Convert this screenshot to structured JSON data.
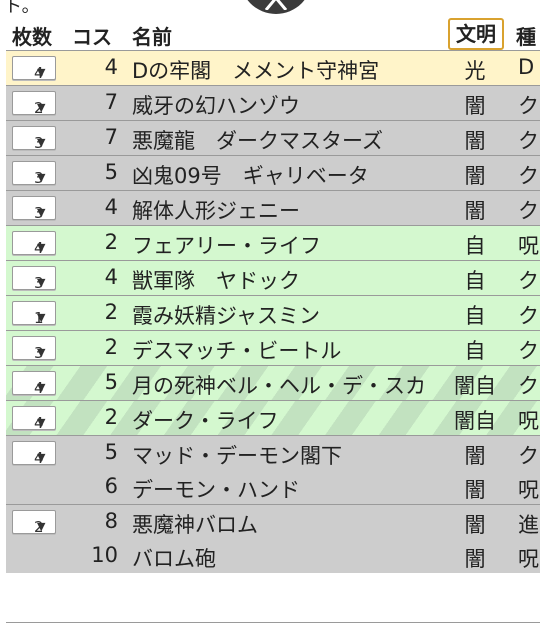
{
  "top_fragment": "ト。",
  "header": {
    "qty": "枚数",
    "cost": "コス",
    "name": "名前",
    "civ": "文明",
    "race": "種"
  },
  "rows": [
    {
      "qty": "4",
      "cost": "4",
      "name": "Dの牢閣　メメント守神宮",
      "civ": "光",
      "race": "D"
    },
    {
      "qty": "2",
      "cost": "7",
      "name": "威牙の幻ハンゾウ",
      "civ": "闇",
      "race": "ク"
    },
    {
      "qty": "3",
      "cost": "7",
      "name": "悪魔龍　ダークマスターズ",
      "civ": "闇",
      "race": "ク"
    },
    {
      "qty": "3",
      "cost": "5",
      "name": "凶鬼09号　ギャリベータ",
      "civ": "闇",
      "race": "ク"
    },
    {
      "qty": "3",
      "cost": "4",
      "name": "解体人形ジェニー",
      "civ": "闇",
      "race": "ク"
    },
    {
      "qty": "4",
      "cost": "2",
      "name": "フェアリー・ライフ",
      "civ": "自",
      "race": "呪"
    },
    {
      "qty": "3",
      "cost": "4",
      "name": "獣軍隊　ヤドック",
      "civ": "自",
      "race": "ク"
    },
    {
      "qty": "1",
      "cost": "2",
      "name": "霞み妖精ジャスミン",
      "civ": "自",
      "race": "ク"
    },
    {
      "qty": "3",
      "cost": "2",
      "name": "デスマッチ・ビートル",
      "civ": "自",
      "race": "ク"
    },
    {
      "qty": "4",
      "cost": "5",
      "name": "月の死神ベル・ヘル・デ・スカ",
      "civ": "闇自",
      "race": "ク"
    },
    {
      "qty": "4",
      "cost": "2",
      "name": "ダーク・ライフ",
      "civ": "闇自",
      "race": "呪"
    },
    {
      "qty": "4",
      "cost": "5",
      "name": "マッド・デーモン閣下",
      "civ": "闇",
      "race": "ク"
    },
    {
      "qty": "",
      "cost": "6",
      "name": "デーモン・ハンド",
      "civ": "闇",
      "race": "呪"
    },
    {
      "qty": "2",
      "cost": "8",
      "name": "悪魔神バロム",
      "civ": "闇",
      "race": "進"
    },
    {
      "qty": "",
      "cost": "10",
      "name": "バロム砲",
      "civ": "闇",
      "race": "呪"
    }
  ],
  "colors": {
    "light": "#fff4c9",
    "dark": "#cdcdcd",
    "nature": "#d4f8cf",
    "accent_border": "#d9a22f"
  },
  "icons": {
    "close": "close-icon",
    "dropdown": "chevron-down-icon"
  }
}
